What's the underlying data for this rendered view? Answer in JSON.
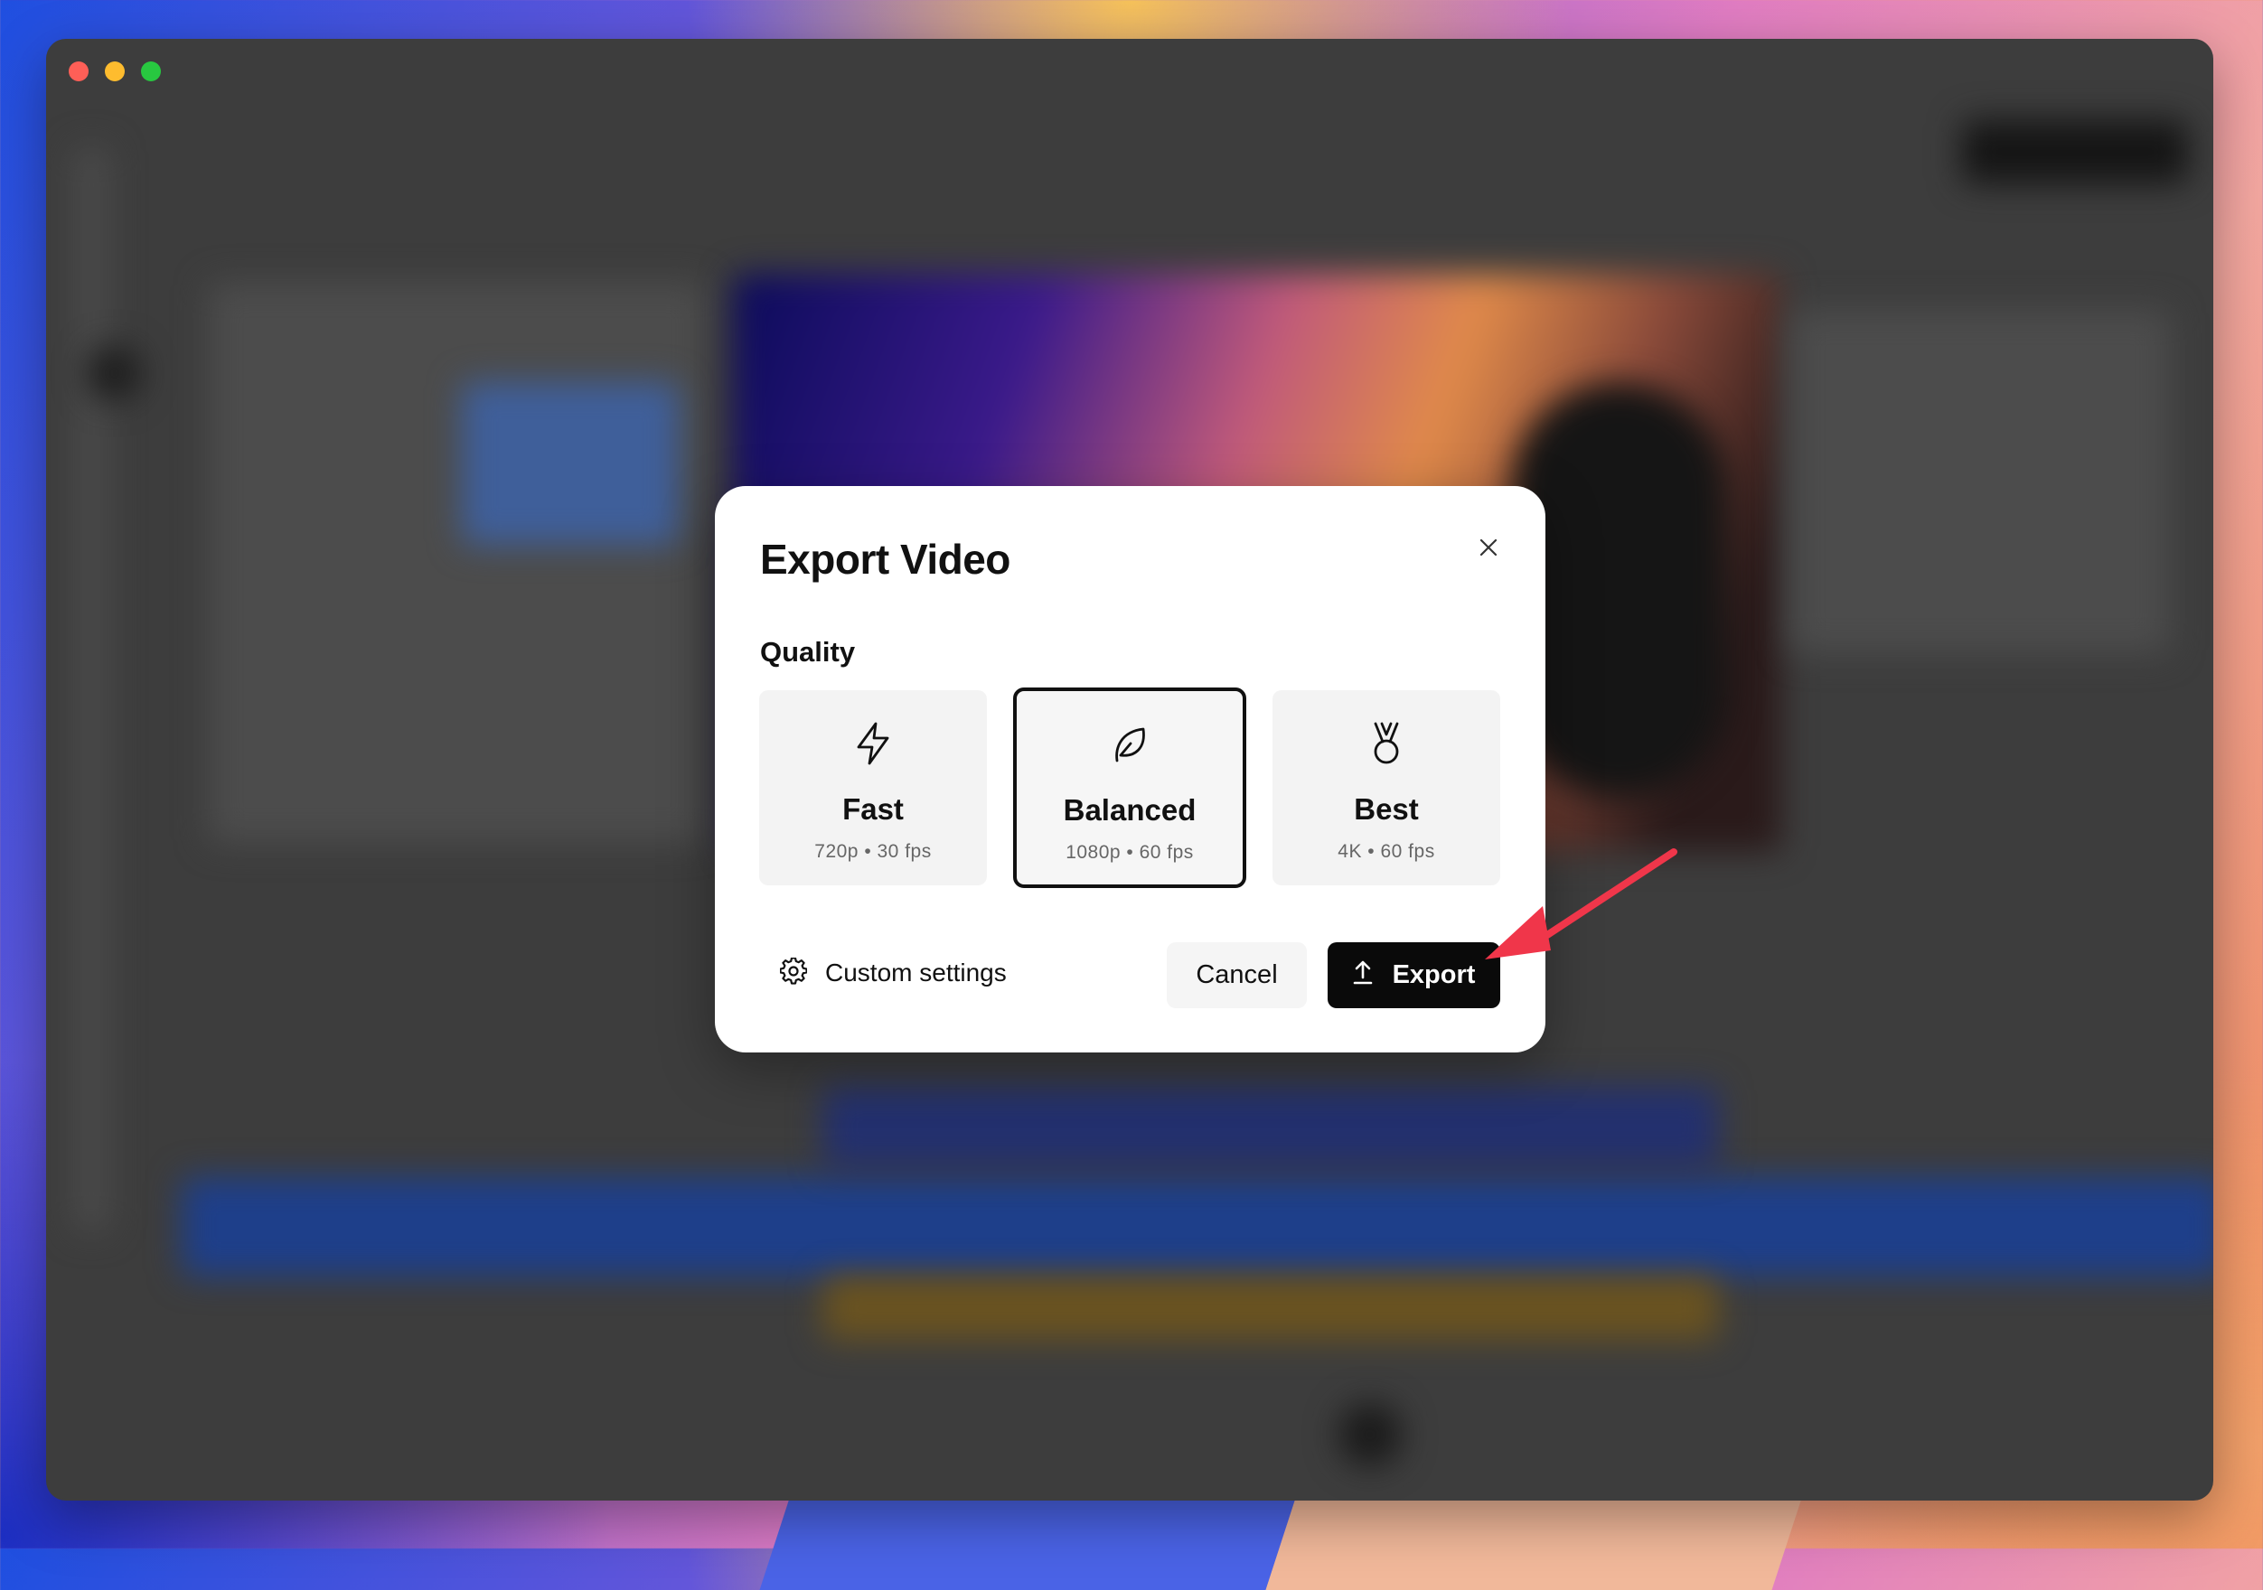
{
  "window": {
    "controls": [
      "close",
      "minimize",
      "maximize"
    ]
  },
  "dialog": {
    "title": "Export Video",
    "close_icon": "close-icon",
    "quality_label": "Quality",
    "options": [
      {
        "name": "Fast",
        "detail": "720p • 30 fps",
        "icon": "lightning-icon",
        "selected": false
      },
      {
        "name": "Balanced",
        "detail": "1080p • 60 fps",
        "icon": "leaf-icon",
        "selected": true
      },
      {
        "name": "Best",
        "detail": "4K • 60 fps",
        "icon": "medal-icon",
        "selected": false
      }
    ],
    "custom_settings_label": "Custom settings",
    "cancel_label": "Cancel",
    "export_label": "Export"
  },
  "annotation": {
    "arrow_color": "#f0364a",
    "points_to": "export-button"
  },
  "colors": {
    "window_background": "#3d3d3d",
    "dialog_background": "#ffffff",
    "primary_button": "#0a0a0a",
    "selected_border": "#111111"
  }
}
